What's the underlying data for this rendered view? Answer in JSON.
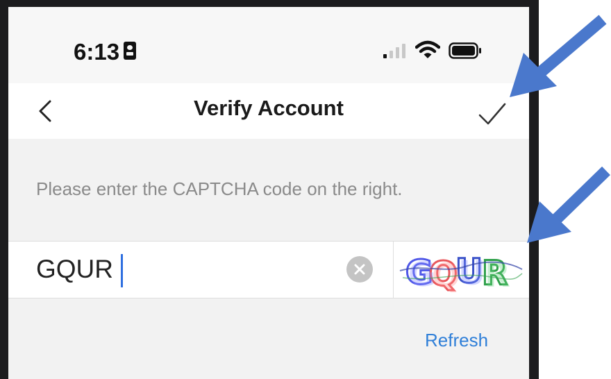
{
  "status_bar": {
    "time": "6:13"
  },
  "nav": {
    "title": "Verify Account",
    "back_icon": "chevron-left-icon",
    "confirm_icon": "checkmark-icon"
  },
  "content": {
    "instruction": "Please enter the CAPTCHA code on the right.",
    "captcha_input_value": "GQUR",
    "captcha_image_text": "GQUR",
    "refresh_label": "Refresh"
  },
  "colors": {
    "link": "#2f7fd8",
    "caret": "#2f6fe0",
    "annotation_arrow": "#4a78cc"
  }
}
